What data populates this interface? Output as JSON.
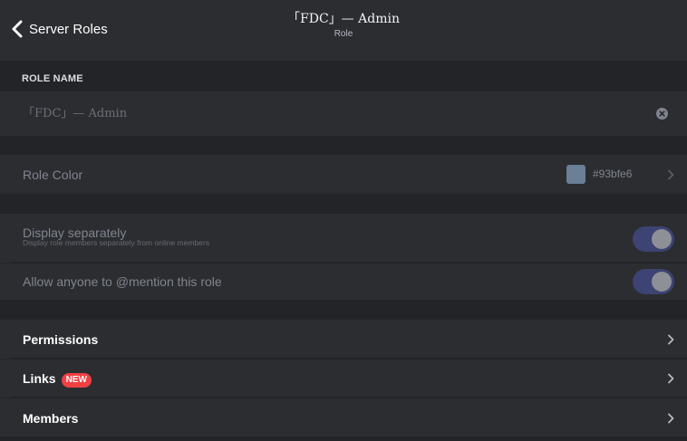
{
  "header": {
    "back_label": "Server Roles",
    "title": "「FDC」— Admin",
    "subtitle": "Role"
  },
  "role_name": {
    "section_label": "ROLE NAME",
    "value": "「FDC」— Admin"
  },
  "role_color": {
    "label": "Role Color",
    "hex": "#93bfe6",
    "swatch_color": "#6b7f96"
  },
  "display_separately": {
    "label": "Display separately",
    "description": "Display role members separately from online members",
    "enabled": true
  },
  "allow_mention": {
    "label": "Allow anyone to @mention this role",
    "enabled": true
  },
  "menu": {
    "permissions": "Permissions",
    "links": "Links",
    "links_badge": "NEW",
    "members": "Members"
  },
  "colors": {
    "toggle_track": "#3d4372",
    "badge": "#f23f42",
    "row_bg": "#2b2d31",
    "page_bg": "#232428"
  },
  "icons": {
    "back": "chevron-left-icon",
    "clear": "clear-circle-icon",
    "nav": "chevron-right-icon"
  }
}
